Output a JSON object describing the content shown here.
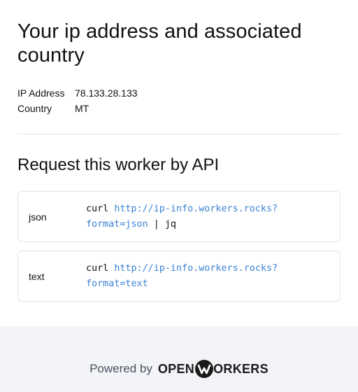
{
  "header": {
    "title": "Your ip address and associated country"
  },
  "info": {
    "rows": [
      {
        "key": "IP Address",
        "value": "78.133.28.133"
      },
      {
        "key": "Country",
        "value": "MT"
      }
    ]
  },
  "api": {
    "title": "Request this worker by API",
    "items": [
      {
        "format": "json",
        "line1_cmd": "curl ",
        "line1_url": "http://ip-info.workers.rocks?",
        "line2_url": "format=json",
        "line2_tail": " | jq"
      },
      {
        "format": "text",
        "line1_cmd": "curl ",
        "line1_url": "http://ip-info.workers.rocks?",
        "line2_url": "format=text",
        "line2_tail": ""
      }
    ]
  },
  "footer": {
    "powered_by": "Powered by",
    "brand_left": "OPEN",
    "brand_right": "ORKERS",
    "logo_icon": "openworkers-w-logo-icon"
  },
  "colors": {
    "link": "#3b82d6",
    "footer_bg": "#f2f4f7",
    "border": "#e3e5e8"
  }
}
